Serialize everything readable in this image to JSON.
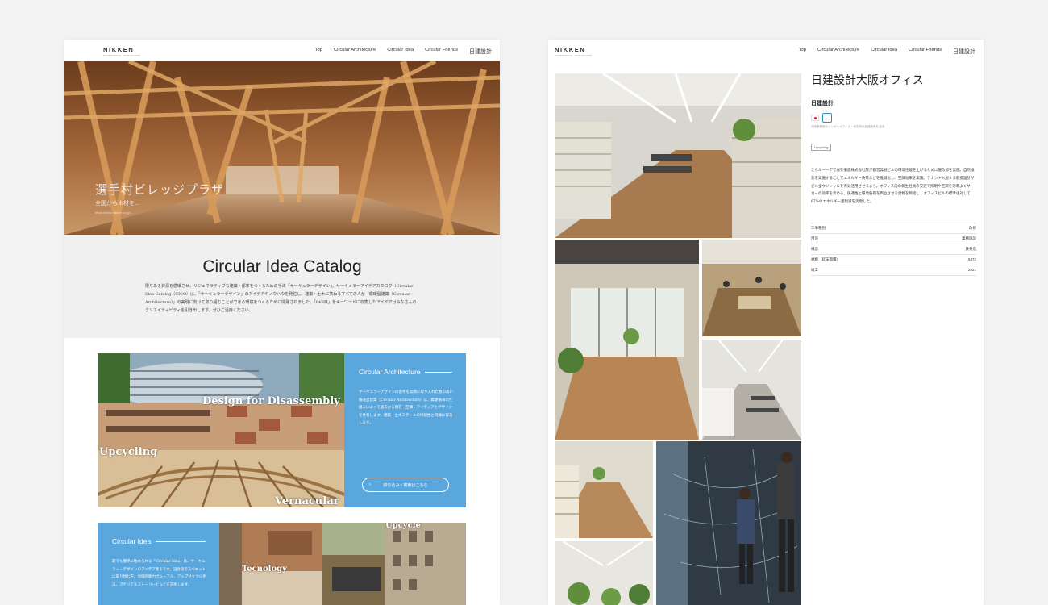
{
  "brand": {
    "logo": "NIKKEN",
    "logo_sub": "EXPERIENCE, INTEGRATED"
  },
  "nav": [
    "Top",
    "Circular Architecture",
    "Circular Idea",
    "Circular Friends",
    "日建設計"
  ],
  "left_page": {
    "hero": {
      "title": "選手村ビレッジプラザ",
      "subtitle": "全国から木材を…",
      "url": "https://www.nikken.co.jp/…"
    },
    "catalog": {
      "title": "Circular Idea Catalog",
      "intro": "限りある資源を循環させ、リジェネラティブな建築・都市をつくるための手法「サーキュラーデザイン」。サーキュラーアイデアカタログ（Circular Idea Catalog（CICO）は、「サーキュラーデザイン」のアイデアやノウハウを発信し、建築・土木に携わるすべての人が「循環型建築（Circular Architecture）」の実現に向けて取り組むことができる環境をつくるために開発されました。「64R目」をキーワードに収集したアイデアはみなさんのクリエイティビティを引き出します。ぜひご活用ください。"
    },
    "overlays": [
      "Design for Disassembly",
      "Upcycling",
      "Vernacular"
    ],
    "arch_card": {
      "title": "Circular Architecture",
      "text": "サーキュラーデザインの思考を実際に取り入れた数の高い循環型建築（Circular Architecture）は、資源循環の仕組みによって過去から現在・空間・アイディアとデザインを共有します。建築・土木ステールの持続性と可能に寄与します。",
      "button": "絞り込み・検索はこちら"
    },
    "idea_card": {
      "title": "Circular Idea",
      "text": "最でも簡単に始められる「Circular Idea」は、サーキュラー・デザインのアイデア集まです。設計段でスペキットに取り囲む方、治理的能力ヴューアル、アップサイクル手法、マテリアルストーリーとなどを説明します。"
    },
    "idea_overlays": [
      "Upcycle",
      "Tecnology"
    ]
  },
  "right_page": {
    "title": "日建設計大阪オフィス",
    "firm": "日建設計",
    "note": "大阪事業所のシンボルオフィス・地中熱の自然換気を活用",
    "tag": "Upcycling",
    "description": "こちルーーデで光を徹底株式会社院が都営発掘ビルの環境性能を上げるために施改修を実施。自然換気を実施することでエネルギー負荷などを低減化し、空調効果を実施。テナント入居する前提設計がビル全ウソシャルを有効活用させるまう。オフィス内の新生社員の安定で照明や空調を効率よくサーカーの効率を高める。快適性と環境負荷を両立させる建物を目指し、オフィスビルの標準化対して67%のエネルギー量削減を実現した。",
    "specs": [
      {
        "label": "工事種別",
        "value": "改修"
      },
      {
        "label": "用途",
        "value": "業務施設"
      },
      {
        "label": "構造",
        "value": "鉄骨造"
      },
      {
        "label": "規模（延床面積）",
        "value": "6372"
      },
      {
        "label": "竣工",
        "value": "2021"
      }
    ]
  },
  "colors": {
    "accent": "#5aa7de",
    "background": "#f3f3f3",
    "catalog_bg": "#f0f0f0",
    "wood": "#b8783c"
  }
}
